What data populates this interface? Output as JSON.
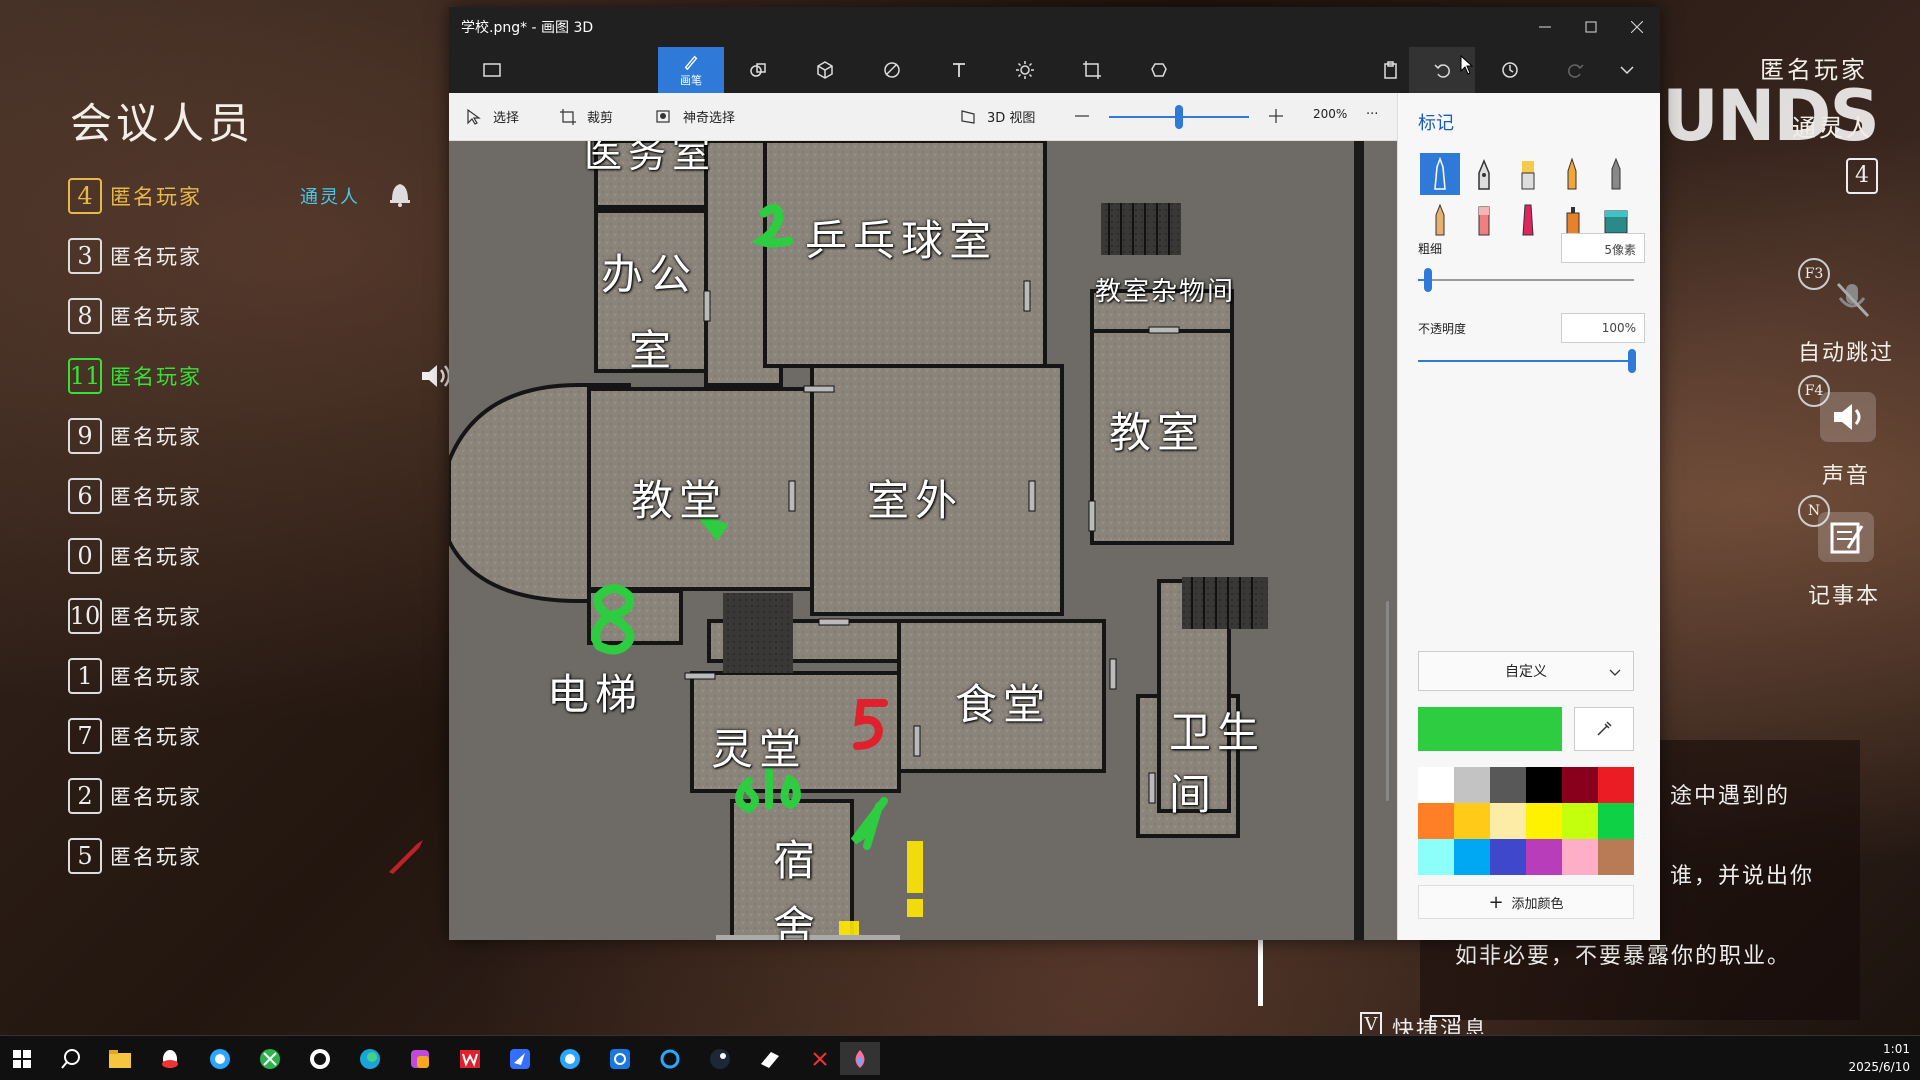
{
  "meeting": {
    "title": "会议人员",
    "players": [
      {
        "num": "4",
        "name": "匿名玩家",
        "role": "通灵人",
        "style": "gold"
      },
      {
        "num": "3",
        "name": "匿名玩家"
      },
      {
        "num": "8",
        "name": "匿名玩家"
      },
      {
        "num": "11",
        "name": "匿名玩家",
        "style": "green"
      },
      {
        "num": "9",
        "name": "匿名玩家"
      },
      {
        "num": "6",
        "name": "匿名玩家"
      },
      {
        "num": "0",
        "name": "匿名玩家"
      },
      {
        "num": "10",
        "name": "匿名玩家"
      },
      {
        "num": "1",
        "name": "匿名玩家"
      },
      {
        "num": "7",
        "name": "匿名玩家"
      },
      {
        "num": "2",
        "name": "匿名玩家"
      },
      {
        "num": "5",
        "name": "匿名玩家"
      }
    ]
  },
  "right_hud": {
    "player_name": "匿名玩家",
    "player_role": "通灵人",
    "player_num": "4",
    "bg_logo_text": "UNDS",
    "key_f3": "F3",
    "auto_skip": "自动跳过",
    "key_f4": "F4",
    "sound": "声音",
    "key_n": "N",
    "notebook": "记事本"
  },
  "chat": {
    "lines": [
      "途中遇到的",
      "谁，并说出你",
      "如非必要，不要暴露你的职业。"
    ],
    "quick_key": "V",
    "quick_label": "快捷消息"
  },
  "paint": {
    "window_title": "学校.png* - 画图 3D",
    "brush_tab_label": "画笔",
    "sub_toolbar": {
      "select": "选择",
      "crop": "裁剪",
      "magic_select": "神奇选择",
      "view3d": "3D 视图",
      "zoom": "200%",
      "more": "···"
    },
    "map_rooms": {
      "office_top": "医务室",
      "office": "办公",
      "office2": "室",
      "pingpong": "乒乓球室",
      "storage": "教室杂物间",
      "church": "教堂",
      "outdoor": "室外",
      "classroom": "教室",
      "elevator": "电梯",
      "spirit_hall": "灵堂",
      "canteen": "食堂",
      "toilet": "卫生",
      "toilet2": "间",
      "dorm": "宿",
      "dorm2": "舍"
    },
    "annotations": {
      "a2": "2",
      "a8": "8",
      "a5": "5",
      "a610": "610",
      "a4": "4",
      "a1": "!"
    },
    "panel": {
      "title": "标记",
      "thickness_label": "粗细",
      "thickness_value": "5像素",
      "opacity_label": "不透明度",
      "opacity_value": "100%",
      "color_mode": "自定义",
      "add_color": "添加颜色",
      "current_color": "#2ecc40",
      "palette": [
        "#ffffff",
        "#c3c3c3",
        "#585858",
        "#000000",
        "#88001b",
        "#ec1c24",
        "#ff7f27",
        "#ffca18",
        "#fdeca6",
        "#fff200",
        "#c4ff0e",
        "#0ed145",
        "#8cfffb",
        "#00a8f3",
        "#3f48cc",
        "#b83dba",
        "#ffaec8",
        "#b97a56"
      ]
    }
  },
  "taskbar": {
    "time": "1:01",
    "date": "2025/6/10"
  }
}
